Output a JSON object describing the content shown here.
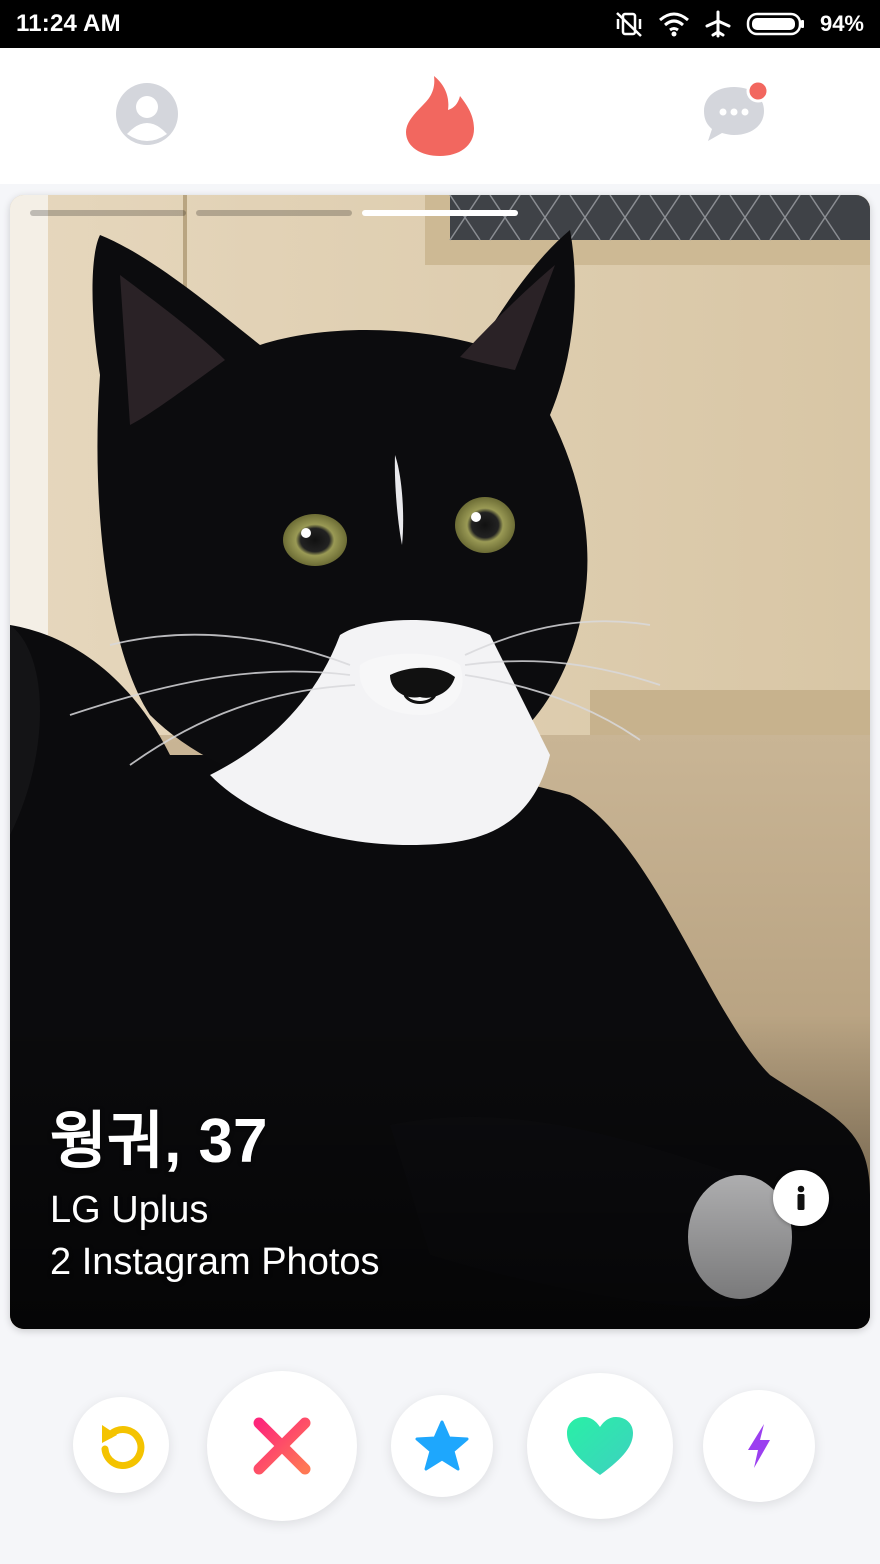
{
  "status_bar": {
    "time": "11:24 AM",
    "battery_percent": "94%",
    "icons": [
      "vibrate-off-icon",
      "wifi-icon",
      "airplane-icon",
      "battery-icon"
    ]
  },
  "top_nav": {
    "icons": [
      "profile-icon",
      "flame-icon",
      "messages-icon"
    ],
    "colors": {
      "flame": "#f2675f",
      "inactive": "#d4d6dc",
      "notification": "#f2675f"
    }
  },
  "profile_card": {
    "photo_count": 3,
    "active_photo_index": 3,
    "name_age": "웡궈, 37",
    "work": "LG Uplus",
    "instagram": "2 Instagram Photos"
  },
  "actions": {
    "icons": [
      "rewind-icon",
      "nope-icon",
      "super-like-icon",
      "like-icon",
      "boost-icon"
    ],
    "colors": {
      "rewind": "#f4c300",
      "nope": "#f5576c",
      "super_like": "#1ea7fd",
      "like": "#3de0b0",
      "boost": "#9b3ff0"
    }
  }
}
